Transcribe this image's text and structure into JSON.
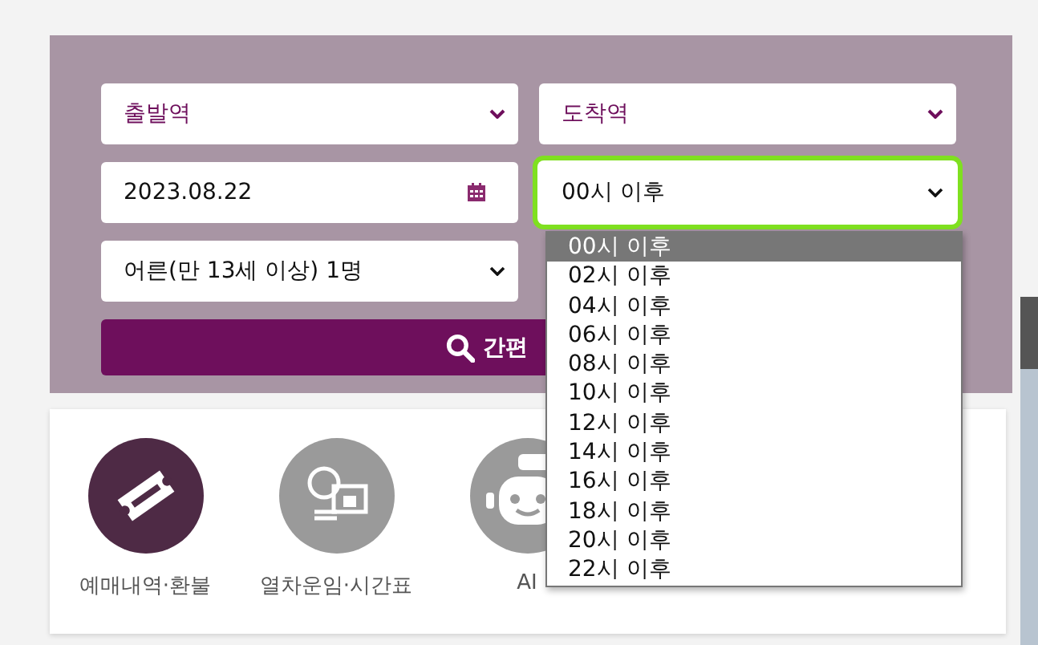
{
  "search": {
    "departure": {
      "placeholder": "출발역"
    },
    "arrival": {
      "placeholder": "도착역"
    },
    "date": {
      "value": "2023.08.22"
    },
    "time": {
      "value": "00시 이후",
      "expanded": true
    },
    "passengers": {
      "value": "어른(만 13세 이상) 1명"
    },
    "button": "간편"
  },
  "time_options": [
    {
      "label": "00시 이후",
      "selected": true
    },
    {
      "label": "02시 이후",
      "selected": false
    },
    {
      "label": "04시 이후",
      "selected": false
    },
    {
      "label": "06시 이후",
      "selected": false
    },
    {
      "label": "08시 이후",
      "selected": false
    },
    {
      "label": "10시 이후",
      "selected": false
    },
    {
      "label": "12시 이후",
      "selected": false
    },
    {
      "label": "14시 이후",
      "selected": false
    },
    {
      "label": "16시 이후",
      "selected": false
    },
    {
      "label": "18시 이후",
      "selected": false
    },
    {
      "label": "20시 이후",
      "selected": false
    },
    {
      "label": "22시 이후",
      "selected": false
    }
  ],
  "quick_menu": [
    {
      "label": "예매내역·환불",
      "kind": "ticket",
      "selected": true
    },
    {
      "label": "열차운임·시간표",
      "kind": "fare",
      "selected": false
    },
    {
      "label": "AI",
      "kind": "chatbot",
      "selected": false
    }
  ]
}
